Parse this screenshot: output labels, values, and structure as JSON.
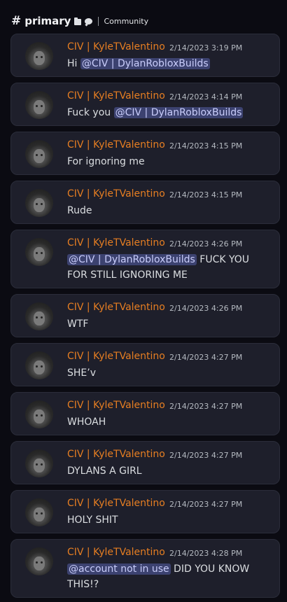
{
  "header": {
    "hash_symbol": "#",
    "channel_name": "primary",
    "category": "Community"
  },
  "messages": [
    {
      "username": "CIV | KyleTValentino",
      "timestamp": "2/14/2023 3:19 PM",
      "text_before": "Hi ",
      "mention": "@CIV | DylanRobloxBuilds",
      "text_after": ""
    },
    {
      "username": "CIV | KyleTValentino",
      "timestamp": "2/14/2023 4:14 PM",
      "text_before": "Fuck you ",
      "mention": "@CIV | DylanRobloxBuilds",
      "text_after": ""
    },
    {
      "username": "CIV | KyleTValentino",
      "timestamp": "2/14/2023 4:15 PM",
      "text_before": "For ignoring me",
      "mention": "",
      "text_after": ""
    },
    {
      "username": "CIV | KyleTValentino",
      "timestamp": "2/14/2023 4:15 PM",
      "text_before": "Rude",
      "mention": "",
      "text_after": ""
    },
    {
      "username": "CIV | KyleTValentino",
      "timestamp": "2/14/2023 4:26 PM",
      "text_before": "",
      "mention": "@CIV | DylanRobloxBuilds",
      "text_after": " FUCK YOU FOR STILL IGNORING ME"
    },
    {
      "username": "CIV | KyleTValentino",
      "timestamp": "2/14/2023 4:26 PM",
      "text_before": "WTF",
      "mention": "",
      "text_after": ""
    },
    {
      "username": "CIV | KyleTValentino",
      "timestamp": "2/14/2023 4:27 PM",
      "text_before": "SHE’v",
      "mention": "",
      "text_after": ""
    },
    {
      "username": "CIV | KyleTValentino",
      "timestamp": "2/14/2023 4:27 PM",
      "text_before": "WHOAH",
      "mention": "",
      "text_after": ""
    },
    {
      "username": "CIV | KyleTValentino",
      "timestamp": "2/14/2023 4:27 PM",
      "text_before": "DYLANS A GIRL",
      "mention": "",
      "text_after": ""
    },
    {
      "username": "CIV | KyleTValentino",
      "timestamp": "2/14/2023 4:27 PM",
      "text_before": "HOLY SHIT",
      "mention": "",
      "text_after": ""
    },
    {
      "username": "CIV | KyleTValentino",
      "timestamp": "2/14/2023 4:28 PM",
      "text_before": "",
      "mention": "@account not in use",
      "text_after": " DID YOU KNOW THIS!?"
    }
  ],
  "colors": {
    "username": "#e67e22",
    "mention_bg": "#3c4270",
    "mention_text": "#c9cdfb",
    "card_bg": "#1e1f2b",
    "page_bg": "#0b0b12"
  }
}
